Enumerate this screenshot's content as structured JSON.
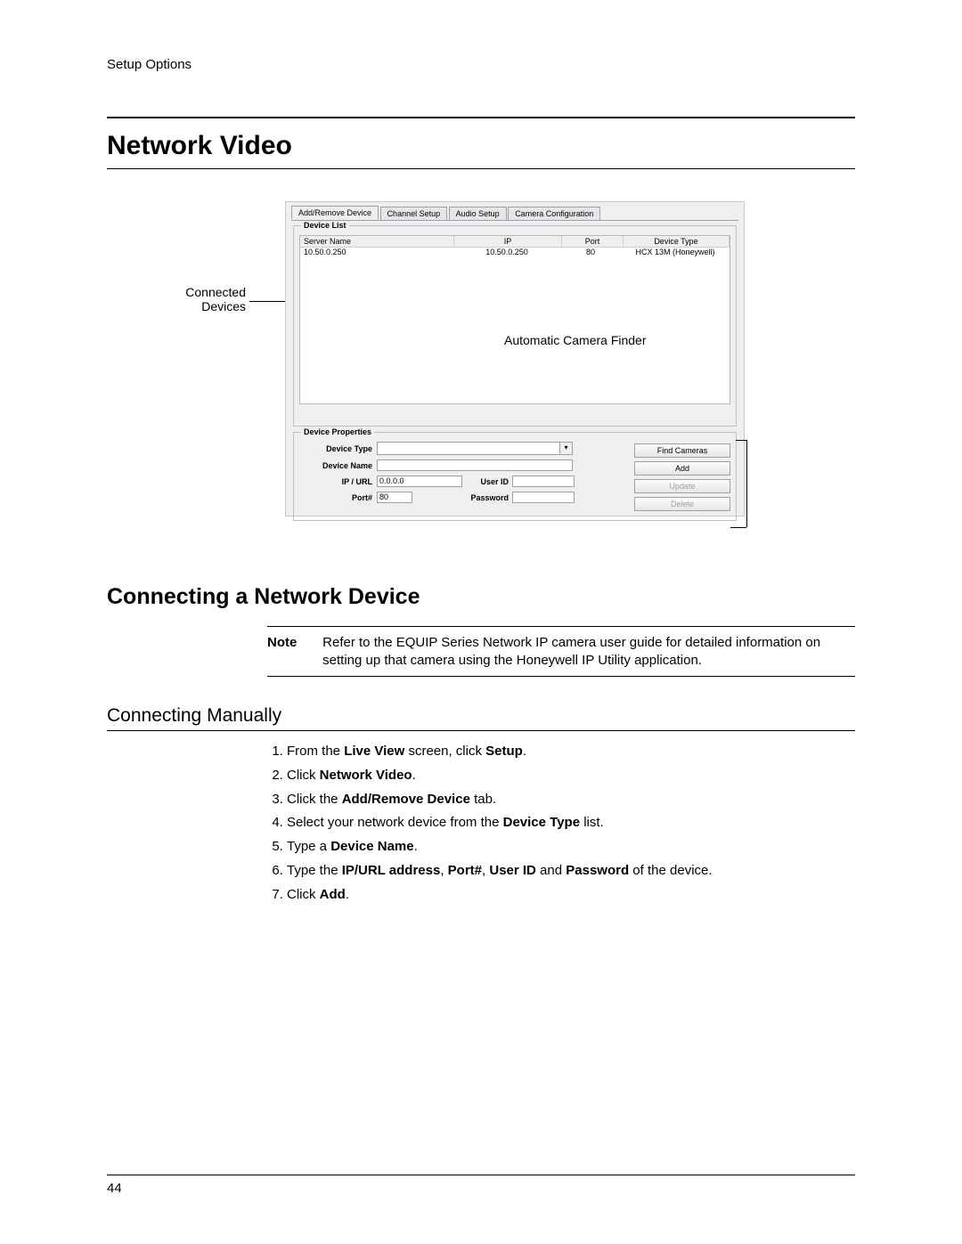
{
  "header": {
    "section": "Setup Options"
  },
  "title": "Network Video",
  "figure": {
    "annot_left_line1": "Connected",
    "annot_left_line2": "Devices",
    "annot_right": "Automatic Camera Finder",
    "tabs": {
      "t0": "Add/Remove Device",
      "t1": "Channel Setup",
      "t2": "Audio Setup",
      "t3": "Camera Configuration"
    },
    "group_list": "Device List",
    "group_props": "Device Properties",
    "cols": {
      "sn": "Server Name",
      "ip": "IP",
      "port": "Port",
      "dt": "Device Type"
    },
    "row": {
      "sn": "10.50.0.250",
      "ip": "10.50.0.250",
      "port": "80",
      "dt": "HCX 13M (Honeywell)"
    },
    "labels": {
      "device_type": "Device Type",
      "device_name": "Device Name",
      "ip_url": "IP / URL",
      "port_num": "Port#",
      "user_id": "User ID",
      "password": "Password"
    },
    "values": {
      "ip": "0.0.0.0",
      "port": "80"
    },
    "buttons": {
      "find": "Find Cameras",
      "add": "Add",
      "update": "Update",
      "delete": "Delete"
    }
  },
  "section2": "Connecting a Network Device",
  "note": {
    "label": "Note",
    "text": "Refer to the EQUIP Series Network IP camera user guide for detailed information on setting up that camera using the Honeywell IP Utility application."
  },
  "subsection": "Connecting Manually",
  "steps": {
    "s1a": "From the ",
    "s1b": "Live View",
    "s1c": " screen, click ",
    "s1d": "Setup",
    "s1e": ".",
    "s2a": "Click ",
    "s2b": "Network Video",
    "s2c": ".",
    "s3a": "Click the ",
    "s3b": "Add/Remove Device",
    "s3c": " tab.",
    "s4a": "Select your network device from the ",
    "s4b": "Device Type",
    "s4c": " list.",
    "s5a": "Type a ",
    "s5b": "Device Name",
    "s5c": ".",
    "s6a": "Type the ",
    "s6b": "IP/URL address",
    "s6c": ", ",
    "s6d": "Port#",
    "s6e": ", ",
    "s6f": "User ID",
    "s6g": " and ",
    "s6h": "Password",
    "s6i": " of the device.",
    "s7a": "Click ",
    "s7b": "Add",
    "s7c": "."
  },
  "page_number": "44"
}
